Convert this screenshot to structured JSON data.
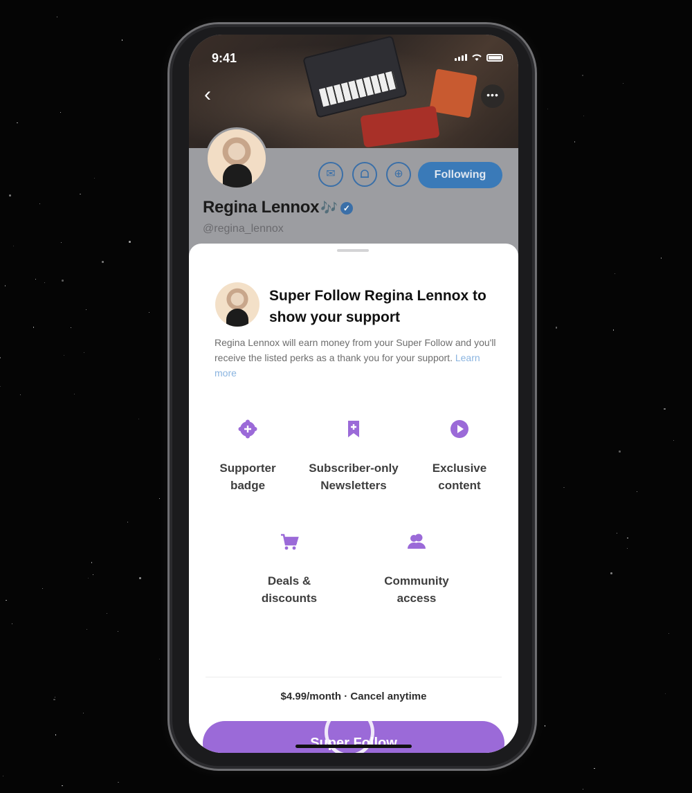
{
  "status_bar": {
    "time": "9:41"
  },
  "header": {
    "back_icon": "chevron-left-icon",
    "more_icon": "more-dots-icon",
    "action_icons": [
      "mail-icon",
      "bell-plus-icon",
      "add-circle-icon"
    ],
    "following_label": "Following"
  },
  "profile": {
    "name": "Regina Lennox",
    "name_emoji": "🎶",
    "handle": "@regina_lennox"
  },
  "sheet": {
    "title": "Super Follow Regina Lennox to show your support",
    "description": "Regina Lennox will earn money from your Super Follow and you'll receive the listed perks as a thank you for your support.",
    "learn_more": "Learn more",
    "perks": [
      {
        "label_line1": "Supporter",
        "label_line2": "badge",
        "icon": "badge-icon"
      },
      {
        "label_line1": "Subscriber-only",
        "label_line2": "Newsletters",
        "icon": "bookmark-plus-icon"
      },
      {
        "label_line1": "Exclusive",
        "label_line2": "content",
        "icon": "play-circle-icon"
      },
      {
        "label_line1": "Deals &",
        "label_line2": "discounts",
        "icon": "cart-icon"
      },
      {
        "label_line1": "Community",
        "label_line2": "access",
        "icon": "community-icon"
      }
    ],
    "price": "$4.99/month · Cancel anytime",
    "cta": "Super Follow"
  },
  "colors": {
    "accent": "#9b6ad8",
    "twitter_blue": "#3a7ab8"
  }
}
